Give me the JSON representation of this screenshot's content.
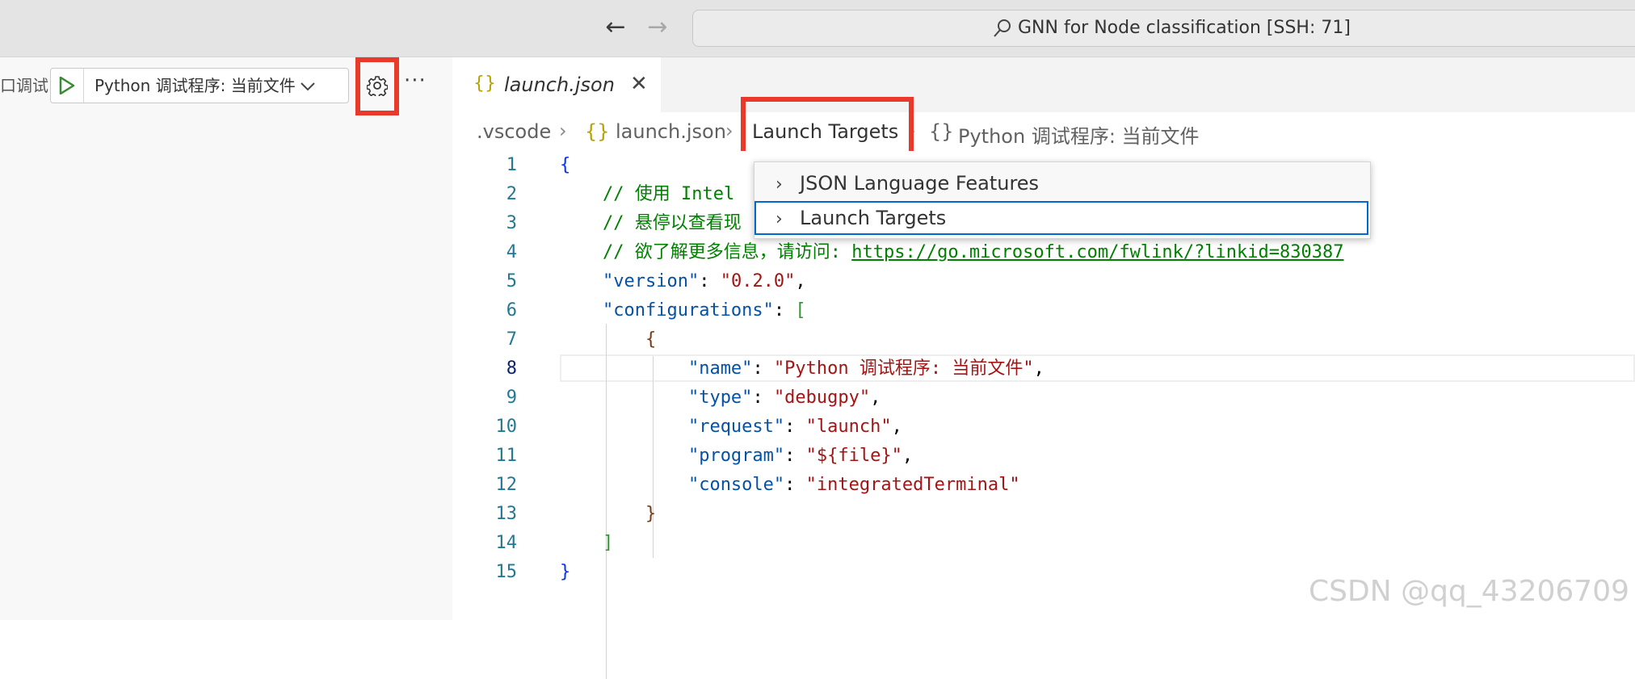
{
  "titlebar": {
    "back_icon": "arrow-left-icon",
    "forward_icon": "arrow-right-icon",
    "command_center_text": "GNN for Node classification [SSH: 71]"
  },
  "debug_panel": {
    "label": "口调试",
    "configuration": "Python 调试程序: 当前文件",
    "more": "···"
  },
  "tab": {
    "icon": "{}",
    "label": "launch.json",
    "close": "✕"
  },
  "breadcrumb": {
    "items": [
      ".vscode",
      "launch.json",
      "Launch Targets",
      "Python 调试程序: 当前文件"
    ],
    "file_icon": "{}",
    "symbol_icon": "{}"
  },
  "popup": {
    "items": [
      "JSON Language Features",
      "Launch Targets"
    ],
    "selected": "Launch Targets"
  },
  "editor": {
    "line_numbers": [
      "1",
      "2",
      "3",
      "4",
      "5",
      "6",
      "7",
      "8",
      "9",
      "10",
      "11",
      "12",
      "13",
      "14",
      "15"
    ],
    "active_line": "8",
    "line2_comment": "// 使用 Intel",
    "line3_comment": "// 悬停以查看现",
    "line4_comment": "// 欲了解更多信息，请访问: ",
    "line4_url": "https://go.microsoft.com/fwlink/?linkid=830387",
    "version_key": "\"version\"",
    "version_value": "\"0.2.0\"",
    "configurations_key": "\"configurations\"",
    "name_key": "\"name\"",
    "name_value": "\"Python 调试程序: 当前文件\"",
    "type_key": "\"type\"",
    "type_value": "\"debugpy\"",
    "request_key": "\"request\"",
    "request_value": "\"launch\"",
    "program_key": "\"program\"",
    "program_value": "\"${file}\"",
    "console_key": "\"console\"",
    "console_value": "\"integratedTerminal\""
  },
  "watermark": "CSDN @qq_43206709",
  "colors": {
    "highlight_border": "#e8392a",
    "json_key": "#0451a5",
    "json_string": "#a31515",
    "comment": "#008000"
  }
}
